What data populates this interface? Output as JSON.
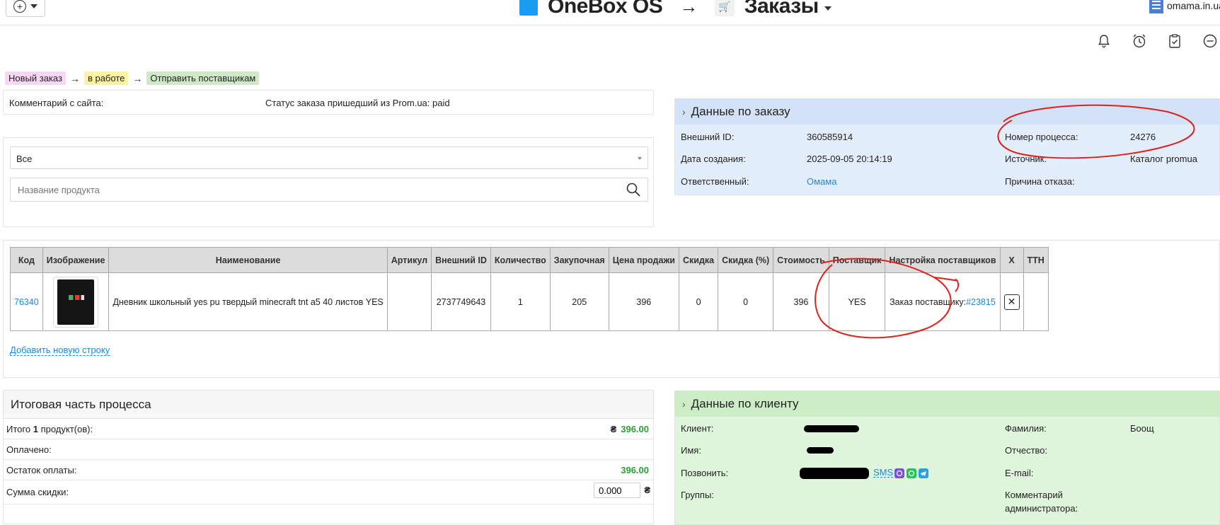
{
  "header": {
    "brand": "OneBox OS",
    "arrow": "→",
    "section": "Заказы",
    "account": "omama.in.ua"
  },
  "icons": {
    "add": "plus-circle-icon",
    "tools": [
      "bell-icon",
      "alarm-clock-icon",
      "clipboard-check-icon",
      "minus-circle-icon"
    ]
  },
  "status_flow": {
    "steps": [
      "Новый заказ",
      "в работе",
      "Отправить поставщикам"
    ],
    "arrow": "→"
  },
  "comment": {
    "label": "Комментарий с сайта:",
    "status": "Статус заказа пришедший из Prom.ua: paid"
  },
  "filter": {
    "selected": "Все",
    "search_placeholder": "Название продукта"
  },
  "order_data": {
    "title": "Данные по заказу",
    "external_id_label": "Внешний ID:",
    "external_id": "360585914",
    "created_label": "Дата создания:",
    "created": "2025-09-05 20:14:19",
    "responsible_label": "Ответственный:",
    "responsible": "Омама",
    "process_label": "Номер процесса:",
    "process": "24276",
    "source_label": "Источник:",
    "source": "Каталог promua",
    "refusal_label": "Причина отказа:"
  },
  "products": {
    "columns": [
      "Код",
      "Изображение",
      "Наименование",
      "Артикул",
      "Внешний ID",
      "Количество",
      "Закупочная",
      "Цена продажи",
      "Скидка",
      "Скидка (%)",
      "Стоимость",
      "Поставщик",
      "Настройка поставщиков",
      "X",
      "ТТН"
    ],
    "rows": [
      {
        "code": "76340",
        "name": "Дневник школьный yes pu твердый minecraft tnt a5 40 листов YES",
        "article": "",
        "external_id": "2737749643",
        "qty": "1",
        "purchase": "205",
        "price": "396",
        "discount": "0",
        "discount_pct": "0",
        "cost": "396",
        "supplier": "YES",
        "supplier_order_label": "Заказ поставщику:",
        "supplier_order_link": "#23815"
      }
    ],
    "add_row": "Добавить новую строку"
  },
  "summary": {
    "title": "Итоговая часть процесса",
    "total_label_pre": "Итого",
    "total_count": "1",
    "total_label_post": "продукт(ов):",
    "currency": "₴",
    "total": "396.00",
    "paid_label": "Оплачено:",
    "rest_label": "Остаток оплаты:",
    "rest": "396.00",
    "discount_label": "Сумма скидки:",
    "discount_value": "0.000"
  },
  "client": {
    "title": "Данные по клиенту",
    "client_label": "Клиент:",
    "name_label": "Имя:",
    "call_label": "Позвонить:",
    "sms": "SMS",
    "groups_label": "Группы:",
    "surname_label": "Фамилия:",
    "surname": "Боощ",
    "patronymic_label": "Отчество:",
    "email_label": "E-mail:",
    "admin_comment_label_1": "Комментарий",
    "admin_comment_label_2": "администратора:"
  },
  "colors": {
    "link": "#1a8be0",
    "order_panel_bg": "#e3eefc",
    "client_panel_bg": "#dff5dc",
    "total_green": "#2e9e3c",
    "annotation_red": "#e0201b"
  }
}
